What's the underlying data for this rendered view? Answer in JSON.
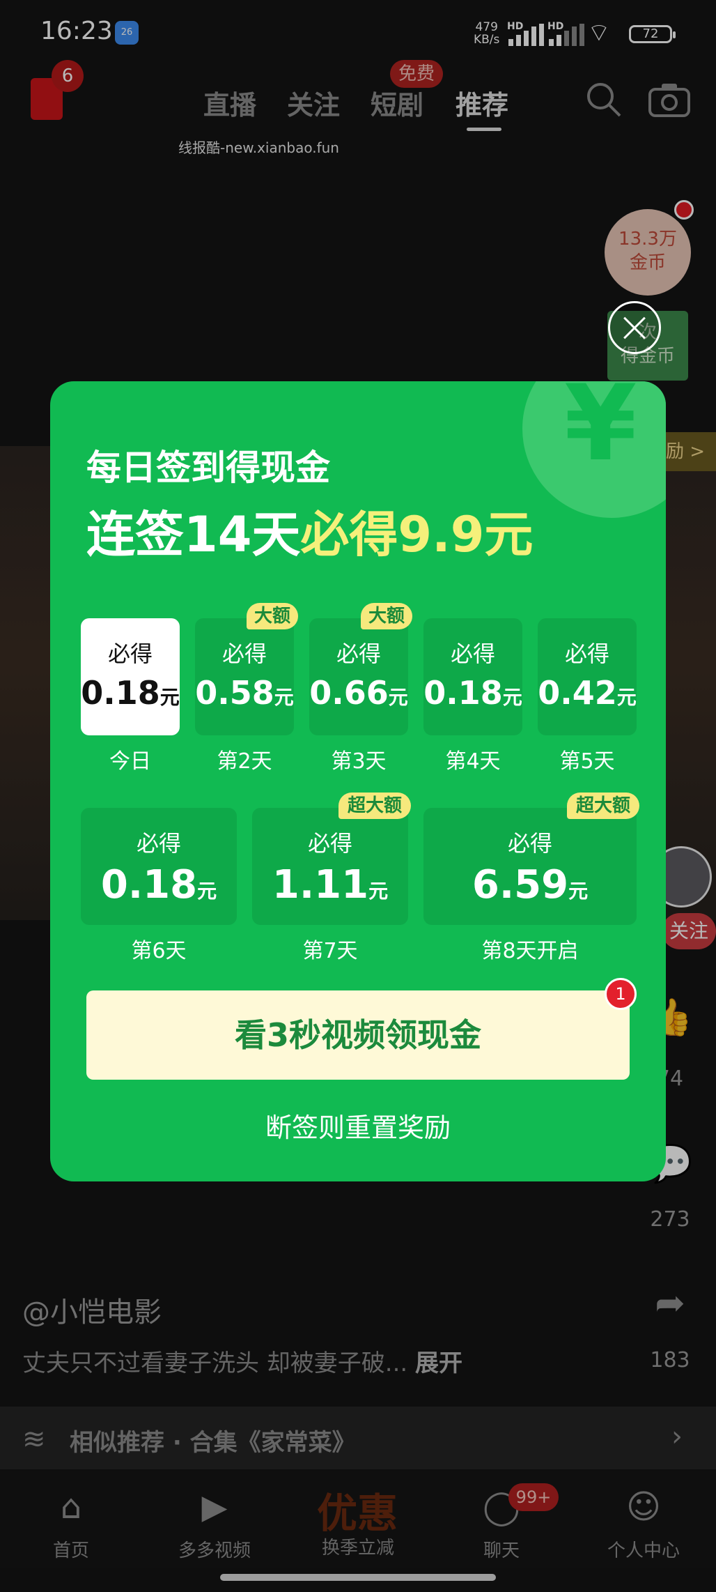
{
  "status_bar": {
    "time": "16:23",
    "weather_badge": "26",
    "net_speed_value": "479",
    "net_speed_unit": "KB/s",
    "hd_label_1": "HD",
    "hd_label_2": "HD",
    "battery": "72"
  },
  "top_nav": {
    "redbag_count": "6",
    "tabs": [
      "直播",
      "关注",
      "短剧",
      "推荐"
    ],
    "active_tab": "推荐",
    "free_badge": "免费"
  },
  "watermark": "线报酷-new.xianbao.fun",
  "side": {
    "coins_line1": "13.3万",
    "coins_line2": "金币",
    "green_line1": "次",
    "green_line2": "得金币",
    "reward_text": "励 >",
    "follow": "关注",
    "likes": "74",
    "comments": "273",
    "shares": "183"
  },
  "video_info": {
    "author": "@小恺电影",
    "description": "丈夫只不过看妻子洗头 却被妻子破...",
    "expand": "展开",
    "similar": "相似推荐 · 合集《家常菜》"
  },
  "bottom_tabs": {
    "home": "首页",
    "videos": "多多视频",
    "promo_big": "优惠",
    "promo_sub": "换季立减",
    "chat": "聊天",
    "chat_badge": "99+",
    "me": "个人中心"
  },
  "popup": {
    "title": "每日签到得现金",
    "headline_prefix": "连签14天",
    "headline_highlight": "必得9.9元",
    "card_label": "必得",
    "unit": "元",
    "row1": [
      {
        "value": "0.18",
        "day": "今日",
        "tag": ""
      },
      {
        "value": "0.58",
        "day": "第2天",
        "tag": "大额"
      },
      {
        "value": "0.66",
        "day": "第3天",
        "tag": "大额"
      },
      {
        "value": "0.18",
        "day": "第4天",
        "tag": ""
      },
      {
        "value": "0.42",
        "day": "第5天",
        "tag": ""
      }
    ],
    "row2": [
      {
        "value": "0.18",
        "day": "第6天",
        "tag": ""
      },
      {
        "value": "1.11",
        "day": "第7天",
        "tag": "超大额"
      },
      {
        "value": "6.59",
        "day": "第8天开启",
        "tag": "超大额"
      }
    ],
    "cta_label": "看3秒视频领现金",
    "cta_badge": "1",
    "reset_note": "断签则重置奖励"
  },
  "colors": {
    "popup_green": "#11ba52",
    "card_green": "#0ea949",
    "highlight_yellow": "#f5f07b",
    "cta_bg": "#fef9d7",
    "badge_red": "#e3202c"
  }
}
